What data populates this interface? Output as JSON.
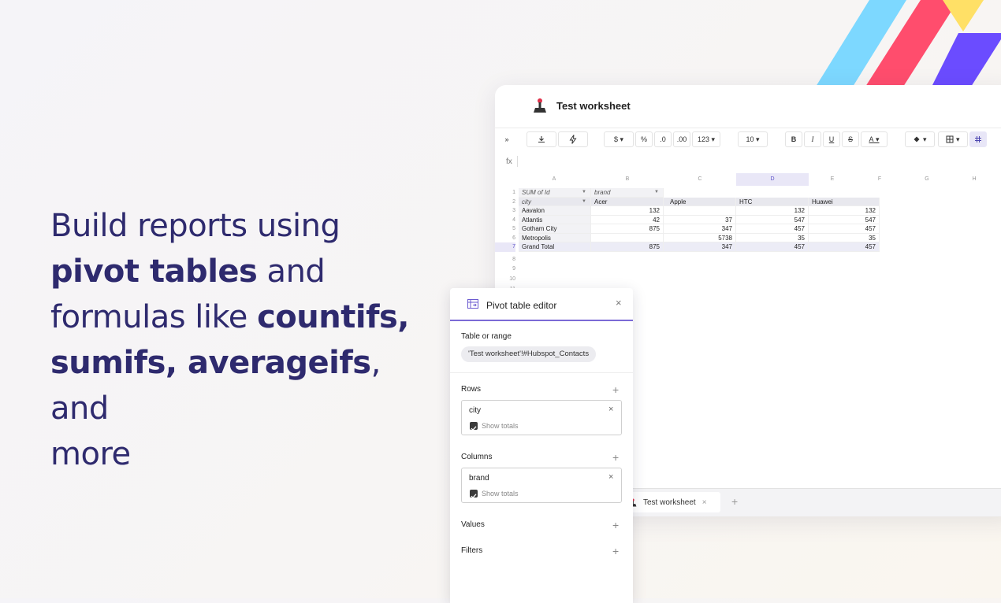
{
  "headline": {
    "l1": "Build reports using",
    "l2_bold": "pivot tables",
    "l2_rest": " and",
    "l3_rest": "formulas like ",
    "l3_bold": "countifs,",
    "l4_bold": "sumifs, averageifs",
    "l4_rest": ", and",
    "l5": "more"
  },
  "colors": {
    "accent": "#7b6ad6",
    "headline": "#2e2a6e",
    "stripe_blue": "#7dd8ff",
    "stripe_red": "#ff4d6d",
    "stripe_yellow": "#ffe066",
    "stripe_purple": "#6b4cff"
  },
  "window": {
    "title": "Test worksheet"
  },
  "toolbar": {
    "font_size": "10",
    "number_format": "123",
    "percent": "%",
    "currency": "$",
    "dec_less": ".0",
    "dec_more": ".00",
    "bold": "B",
    "italic": "I",
    "underline": "U",
    "strike": "S",
    "text_color": "A"
  },
  "formula": {
    "label": "fx"
  },
  "grid": {
    "columns": [
      "A",
      "B",
      "C",
      "D",
      "E",
      "F",
      "G",
      "H"
    ],
    "rows": [
      "1",
      "2",
      "3",
      "4",
      "5",
      "6",
      "7",
      "8",
      "9",
      "10",
      "11"
    ],
    "pivot": {
      "r1": {
        "a": "SUM of Id",
        "b": "brand"
      },
      "headers": [
        "city",
        "Acer",
        "Apple",
        "HTC",
        "Huawei"
      ],
      "data": [
        [
          "Aavalon",
          "132",
          "",
          "132",
          "132"
        ],
        [
          "Atlantis",
          "42",
          "37",
          "547",
          "547"
        ],
        [
          "Gotham City",
          "875",
          "347",
          "457",
          "457"
        ],
        [
          "Metropolis",
          "",
          "5738",
          "35",
          "35"
        ],
        [
          "Grand Total",
          "875",
          "347",
          "457",
          "457"
        ]
      ]
    }
  },
  "tabs": {
    "sheet": "Test worksheet",
    "add": "+"
  },
  "panel": {
    "title": "Pivot table editor",
    "close": "×",
    "range_label": "Table or range",
    "range_value": "'Test worksheet'!#Hubspot_Contacts",
    "rows_label": "Rows",
    "rows_field": "city",
    "rows_show_totals": "Show totals",
    "columns_label": "Columns",
    "columns_field": "brand",
    "columns_show_totals": "Show totals",
    "values_label": "Values",
    "filters_label": "Filters",
    "plus": "+",
    "remove": "×"
  }
}
